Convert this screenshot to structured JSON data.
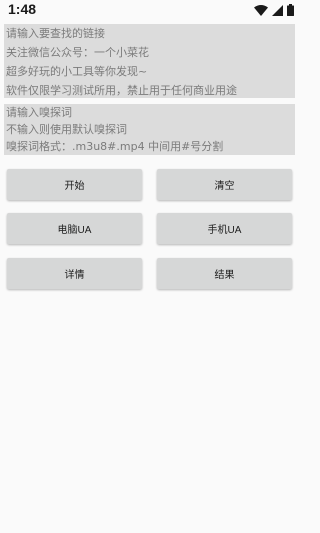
{
  "status_bar": {
    "time": "1:48",
    "icons": [
      "wifi-icon",
      "signal-icon",
      "battery-icon"
    ]
  },
  "link_input": {
    "lines": [
      "请输入要查找的链接",
      "关注微信公众号：一个小菜花",
      "超多好玩的小工具等你发现~",
      "软件仅限学习测试所用，禁止用于任何商业用途"
    ]
  },
  "sniff_input": {
    "lines": [
      "请输入嗅探词",
      "不输入则使用默认嗅探词",
      "嗅探词格式：.m3u8#.mp4 中间用#号分割"
    ]
  },
  "buttons": {
    "start": "开始",
    "clear": "清空",
    "pc_ua": "电脑UA",
    "mobile_ua": "手机UA",
    "details": "详情",
    "results": "结果"
  },
  "colors": {
    "background": "#fafafa",
    "input_background": "#dcdcdc",
    "hint_text": "#7b7b7b",
    "button_background": "#d6d7d7"
  }
}
